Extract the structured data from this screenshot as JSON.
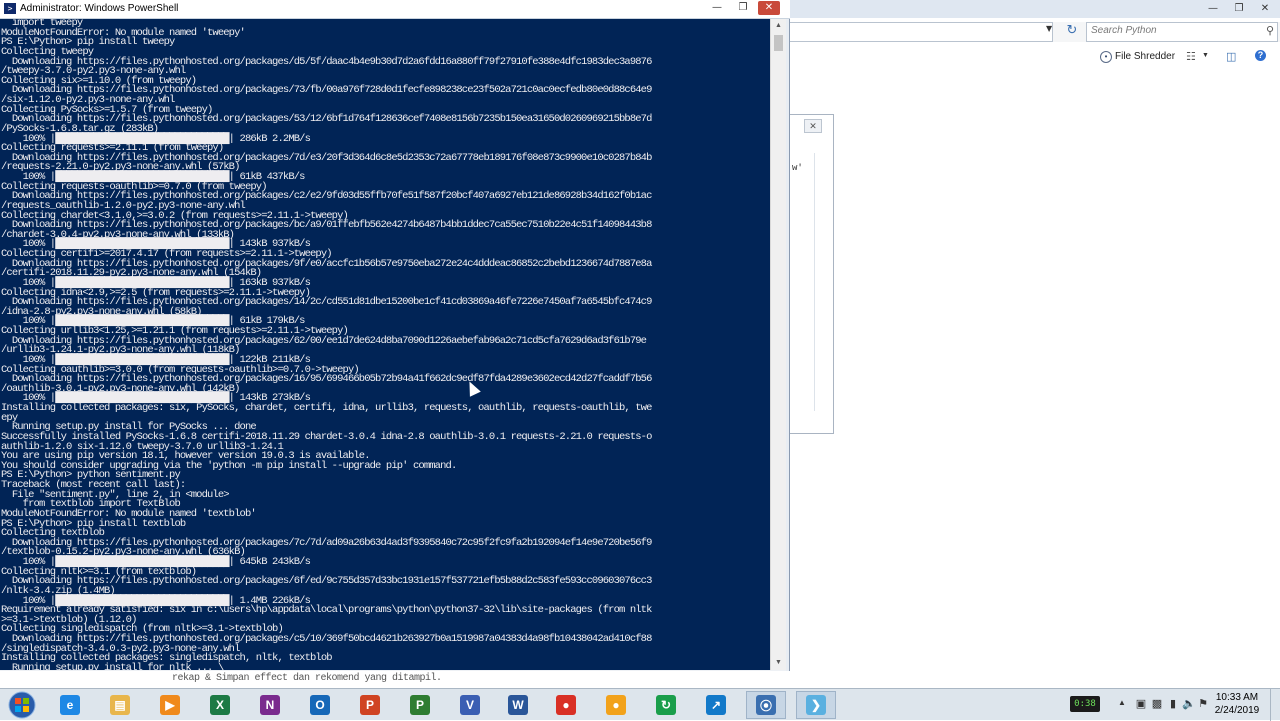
{
  "powershell": {
    "title": "Administrator: Windows PowerShell",
    "console_lines": [
      "  import tweepy",
      "ModuleNotFoundError: No module named 'tweepy'",
      "PS E:\\Python> pip install tweepy",
      "Collecting tweepy",
      "  Downloading https://files.pythonhosted.org/packages/d5/5f/daac4b4e9b30d7d2a6fdd16a880ff79f27910fe388e4dfc1983dec3a9876",
      "/tweepy-3.7.0-py2.py3-none-any.whl",
      "Collecting six>=1.10.0 (from tweepy)",
      "  Downloading https://files.pythonhosted.org/packages/73/fb/00a976f728d0d1fecfe898238ce23f502a721c0ac0ecfedb80e0d88c64e9",
      "/six-1.12.0-py2.py3-none-any.whl",
      "Collecting PySocks>=1.5.7 (from tweepy)",
      "  Downloading https://files.pythonhosted.org/packages/53/12/6bf1d764f128636cef7408e8156b7235b150ea31650d0260969215bb8e7d",
      "/PySocks-1.6.8.tar.gz (283kB)",
      "    100% |████████████████████████████████| 286kB 2.2MB/s",
      "Collecting requests>=2.11.1 (from tweepy)",
      "  Downloading https://files.pythonhosted.org/packages/7d/e3/20f3d364d6c8e5d2353c72a67778eb189176f08e873c9900e10c0287b84b",
      "/requests-2.21.0-py2.py3-none-any.whl (57kB)",
      "    100% |████████████████████████████████| 61kB 437kB/s",
      "Collecting requests-oauthlib>=0.7.0 (from tweepy)",
      "  Downloading https://files.pythonhosted.org/packages/c2/e2/9fd03d55ffb70fe51f587f20bcf407a6927eb121de86928b34d162f0b1ac",
      "/requests_oauthlib-1.2.0-py2.py3-none-any.whl",
      "Collecting chardet<3.1.0,>=3.0.2 (from requests>=2.11.1->tweepy)",
      "  Downloading https://files.pythonhosted.org/packages/bc/a9/01ffebfb562e4274b6487b4bb1ddec7ca55ec7510b22e4c51f14098443b8",
      "/chardet-3.0.4-py2.py3-none-any.whl (133kB)",
      "    100% |████████████████████████████████| 143kB 937kB/s",
      "Collecting certifi>=2017.4.17 (from requests>=2.11.1->tweepy)",
      "  Downloading https://files.pythonhosted.org/packages/9f/e0/accfc1b56b57e9750eba272e24c4dddeac86852c2bebd1236674d7887e8a",
      "/certifi-2018.11.29-py2.py3-none-any.whl (154kB)",
      "    100% |████████████████████████████████| 163kB 937kB/s",
      "Collecting idna<2.9,>=2.5 (from requests>=2.11.1->tweepy)",
      "  Downloading https://files.pythonhosted.org/packages/14/2c/cd551d81dbe15200be1cf41cd03869a46fe7226e7450af7a6545bfc474c9",
      "/idna-2.8-py2.py3-none-any.whl (58kB)",
      "    100% |████████████████████████████████| 61kB 179kB/s",
      "Collecting urllib3<1.25,>=1.21.1 (from requests>=2.11.1->tweepy)",
      "  Downloading https://files.pythonhosted.org/packages/62/00/ee1d7de624d8ba7090d1226aebefab96a2c71cd5cfa7629d6ad3f61b79e",
      "/urllib3-1.24.1-py2.py3-none-any.whl (118kB)",
      "    100% |████████████████████████████████| 122kB 211kB/s",
      "Collecting oauthlib>=3.0.0 (from requests-oauthlib>=0.7.0->tweepy)",
      "  Downloading https://files.pythonhosted.org/packages/16/95/699466b05b72b94a41f662dc9edf87fda4289e3602ecd42d27fcaddf7b56",
      "/oauthlib-3.0.1-py2.py3-none-any.whl (142kB)",
      "    100% |████████████████████████████████| 143kB 273kB/s",
      "Installing collected packages: six, PySocks, chardet, certifi, idna, urllib3, requests, oauthlib, requests-oauthlib, twe",
      "epy",
      "  Running setup.py install for PySocks ... done",
      "Successfully installed PySocks-1.6.8 certifi-2018.11.29 chardet-3.0.4 idna-2.8 oauthlib-3.0.1 requests-2.21.0 requests-o",
      "authlib-1.2.0 six-1.12.0 tweepy-3.7.0 urllib3-1.24.1",
      "You are using pip version 18.1, however version 19.0.3 is available.",
      "You should consider upgrading via the 'python -m pip install --upgrade pip' command.",
      "PS E:\\Python> python sentiment.py",
      "Traceback (most recent call last):",
      "  File \"sentiment.py\", line 2, in <module>",
      "    from textblob import TextBlob",
      "ModuleNotFoundError: No module named 'textblob'",
      "PS E:\\Python> pip install textblob",
      "Collecting textblob",
      "  Downloading https://files.pythonhosted.org/packages/7c/7d/ad09a26b63d4ad3f9395840c72c95f2fc9fa2b192094ef14e9e720be56f9",
      "/textblob-0.15.2-py2.py3-none-any.whl (636kB)",
      "    100% |████████████████████████████████| 645kB 243kB/s",
      "Collecting nltk>=3.1 (from textblob)",
      "  Downloading https://files.pythonhosted.org/packages/6f/ed/9c755d357d33bc1931e157f537721efb5b88d2c583fe593cc09603076cc3",
      "/nltk-3.4.zip (1.4MB)",
      "    100% |████████████████████████████████| 1.4MB 226kB/s",
      "Requirement already satisfied: six in c:\\users\\hp\\appdata\\local\\programs\\python\\python37-32\\lib\\site-packages (from nltk",
      ">=3.1->textblob) (1.12.0)",
      "Collecting singledispatch (from nltk>=3.1->textblob)",
      "  Downloading https://files.pythonhosted.org/packages/c5/10/369f50bcd4621b263927b0a1519987a04383d4a98fb10438042ad410cf88",
      "/singledispatch-3.4.0.3-py2.py3-none-any.whl",
      "Installing collected packages: singledispatch, nltk, textblob",
      "  Running setup.py install for nltk ... \\"
    ]
  },
  "strip": {
    "text": "rekap & Simpan effect dan rekomend yang ditampil."
  },
  "explorer": {
    "search_placeholder": "Search Python",
    "file_shredder_label": "File Shredder",
    "dialog_text": "w'"
  },
  "taskbar": {
    "apps": [
      {
        "name": "ie",
        "glyph": "e",
        "color": "#1e88e5"
      },
      {
        "name": "file-explorer",
        "glyph": "▤",
        "color": "#e8b64c"
      },
      {
        "name": "media-player",
        "glyph": "▶",
        "color": "#f08a1c"
      },
      {
        "name": "excel",
        "glyph": "X",
        "color": "#1d7a45"
      },
      {
        "name": "onenote",
        "glyph": "N",
        "color": "#7a2b8e"
      },
      {
        "name": "outlook",
        "glyph": "O",
        "color": "#1668b8"
      },
      {
        "name": "powerpoint",
        "glyph": "P",
        "color": "#d04423"
      },
      {
        "name": "project",
        "glyph": "P",
        "color": "#2f7d32"
      },
      {
        "name": "visio",
        "glyph": "V",
        "color": "#3b5fb3"
      },
      {
        "name": "word",
        "glyph": "W",
        "color": "#2a5699"
      },
      {
        "name": "chrome",
        "glyph": "●",
        "color": "#d93025"
      },
      {
        "name": "app-orange",
        "glyph": "●",
        "color": "#f2a21b"
      },
      {
        "name": "app-refresh",
        "glyph": "↻",
        "color": "#1a9e4b"
      },
      {
        "name": "app-blue",
        "glyph": "↗",
        "color": "#1279c9"
      },
      {
        "name": "python",
        "glyph": "⦿",
        "color": "#3a6fb0"
      },
      {
        "name": "powershell",
        "glyph": "❯",
        "color": "#5ab0e0"
      }
    ],
    "battery": "0:38",
    "time": "10:33 AM",
    "date": "2/24/2019"
  }
}
